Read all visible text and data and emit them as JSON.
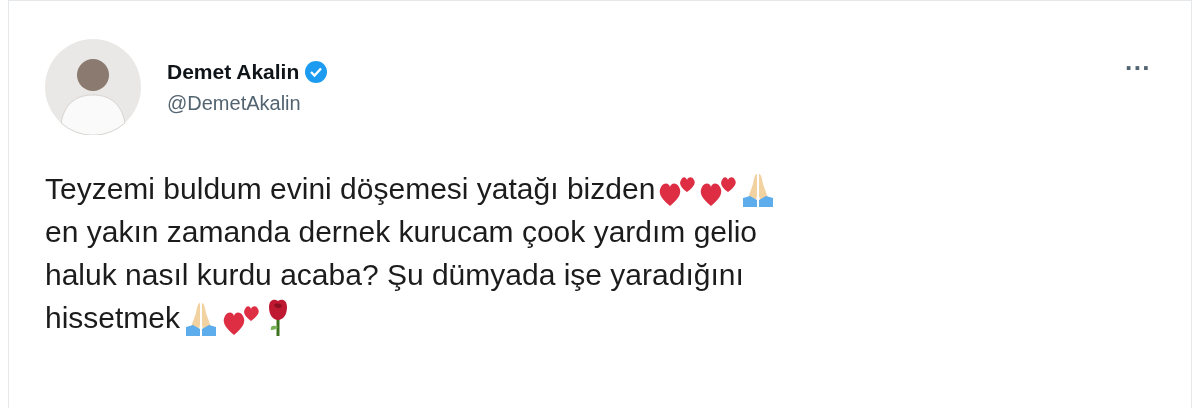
{
  "tweet": {
    "author": {
      "name": "Demet Akalin",
      "verified": true,
      "handle": "@DemetAkalin"
    },
    "more_button": "···",
    "lines": [
      [
        {
          "kind": "text",
          "text": "Teyzemi buldum evini döşemesi yatağı bizden"
        },
        {
          "kind": "hearts"
        },
        {
          "kind": "hearts"
        },
        {
          "kind": "pray"
        }
      ],
      [
        {
          "kind": "text",
          "text": "en yakın zamanda dernek kurucam çook yardım gelio"
        }
      ],
      [
        {
          "kind": "text",
          "text": "haluk nasıl kurdu acaba? Şu dümyada işe yaradığını"
        }
      ],
      [
        {
          "kind": "text",
          "text": "hissetmek"
        },
        {
          "kind": "pray"
        },
        {
          "kind": "hearts"
        },
        {
          "kind": "rose"
        }
      ]
    ]
  }
}
